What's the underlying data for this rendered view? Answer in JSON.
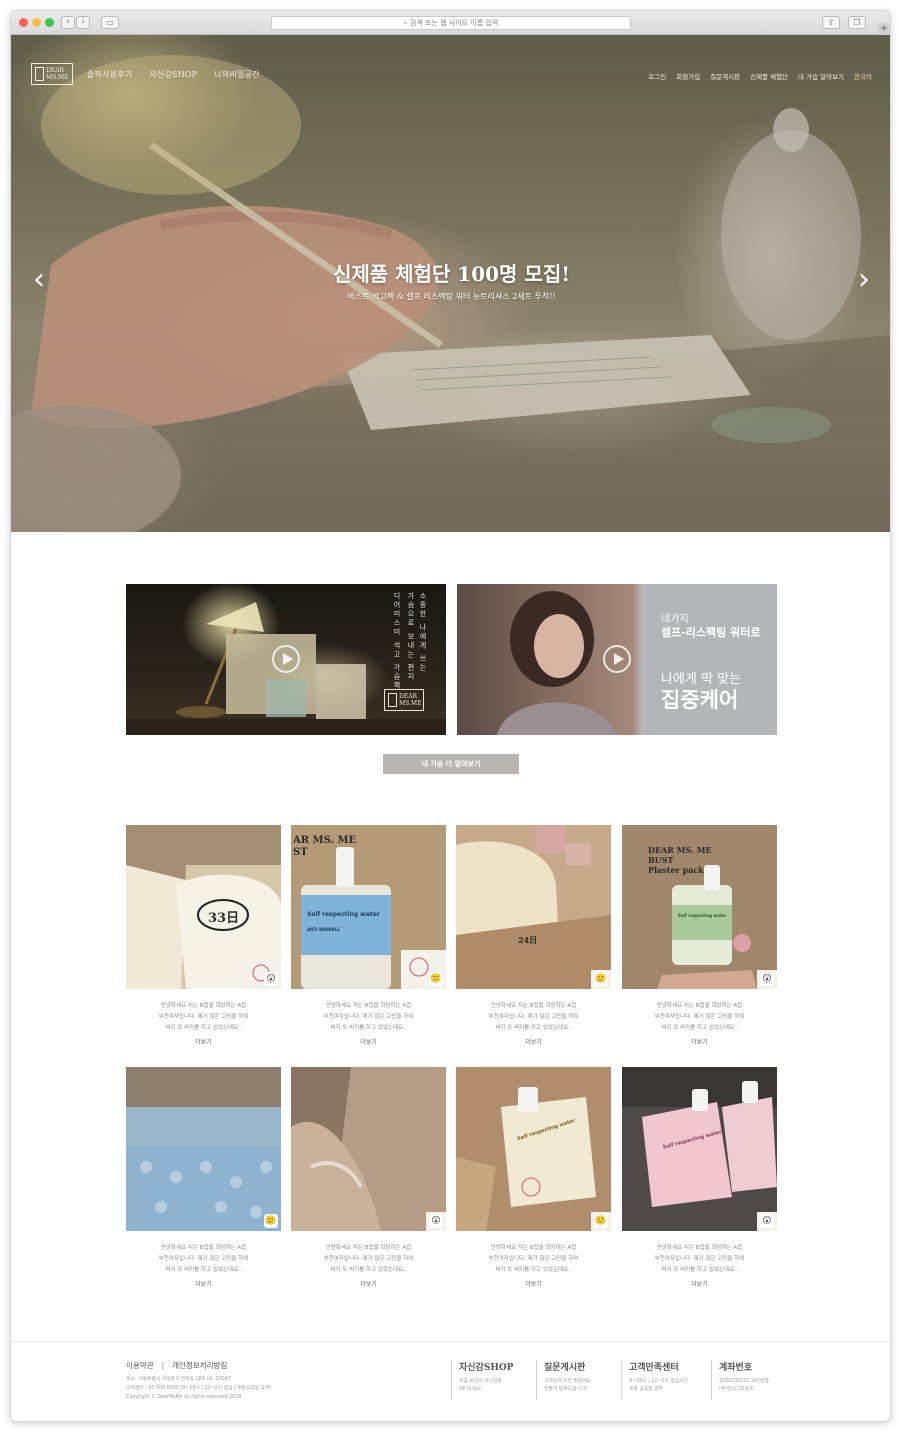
{
  "browser": {
    "address_placeholder": "검색 또는 웹 사이트 이름 입력",
    "back": "‹",
    "forward": "›",
    "new_tab": "+"
  },
  "site": {
    "logo_line1": "DEAR",
    "logo_line2": "MS.ME",
    "main_nav": [
      "솔직사용후기",
      "자신감SHOP",
      "나의비밀공간"
    ],
    "util_nav": [
      "로그인",
      "회원가입",
      "질문게시판",
      "신제품 체험단",
      "내 가슴 알아보기",
      "한국어"
    ]
  },
  "hero": {
    "title": "신제품 체험단 100명 모집!",
    "subtitle": "바스트 석고팩 & 셀프 리스펙팅 워터 뉴트리셔스 2세트 투척!!",
    "prev": "‹",
    "next": "›"
  },
  "videos": {
    "v1_vertical": [
      "소중한 나에게 쓰는",
      "가슴으로 보내는 편지",
      "디어미스미 석고 가슴팩"
    ],
    "v1_badge_line1": "DEAR",
    "v1_badge_line2": "MS.ME",
    "v2_line1": "네가지",
    "v2_line2": "셀프-리스팩팅 워터로",
    "v2_line3": "나에게 딱 맞는",
    "v2_line4": "집중케어"
  },
  "more_button": "내 가슴 더 알아보기",
  "reviews": [
    {
      "text1": "안녕하세요 저는 B컵을 희망하는 A컵",
      "text2": "부천여자입니다. 제가 많은 고민을 하여",
      "text3": "써지 또 써지를 하고 있었는데요..",
      "more": "더보기",
      "emoji": "😲"
    },
    {
      "text1": "안녕하세요 저는 B컵을 희망하는 A컵",
      "text2": "부천여자입니다. 제가 많은 고민을 하여",
      "text3": "써지 또 써지를 하고 있었는데요..",
      "more": "더보기",
      "emoji": "🙂"
    },
    {
      "text1": "안녕하세요 저는 B컵을 희망하는 A컵",
      "text2": "부천여자입니다. 제가 많은 고민을 하여",
      "text3": "써지 또 써지를 하고 있었는데요..",
      "more": "더보기",
      "emoji": "🙂"
    },
    {
      "text1": "안녕하세요 저는 B컵을 희망하는 A컵",
      "text2": "부천여자입니다. 제가 많은 고민을 하여",
      "text3": "써지 또 써지를 하고 있었는데요..",
      "more": "더보기",
      "emoji": "😲"
    },
    {
      "text1": "안녕하세요 저는 B컵을 희망하는 A컵",
      "text2": "부천여자입니다. 제가 많은 고민을 하여",
      "text3": "써지 또 써지를 하고 있었는데요..",
      "more": "더보기",
      "emoji": "🙂"
    },
    {
      "text1": "안녕하세요 저는 B컵을 희망하는 A컵",
      "text2": "부천여자입니다. 제가 많은 고민을 하여",
      "text3": "써지 또 써지를 하고 있었는데요..",
      "more": "더보기",
      "emoji": "😲"
    },
    {
      "text1": "안녕하세요 저는 B컵을 희망하는 A컵",
      "text2": "부천여자입니다. 제가 많은 고민을 하여",
      "text3": "써지 또 써지를 하고 있었는데요..",
      "more": "더보기",
      "emoji": "🙂"
    },
    {
      "text1": "안녕하세요 저는 B컵을 희망하는 A컵",
      "text2": "부천여자입니다. 제가 많은 고민을 하여",
      "text3": "써지 또 써지를 하고 있었는데요..",
      "more": "더보기",
      "emoji": "😲"
    }
  ],
  "thumb_labels": {
    "t1": "33日",
    "t2_brand": "AR MS. ME",
    "t2_brand2": "ST",
    "t2_label": "Self respecting water",
    "t2_label2": "ANTI-WRINKLE",
    "t3": "24日",
    "t4_brand": "DEAR MS. ME",
    "t4_brand2": "BUST",
    "t4_brand3": "Plaster pack",
    "t4_label": "Self respecting water",
    "t7_label": "Self respecting water",
    "t8_label": "Self respecting water"
  },
  "footer": {
    "link1": "이용약관",
    "sep": "|",
    "link2": "개인정보처리방침",
    "info1": "주소: 서울특별시 서대문구 연희동 189-16, 07047",
    "info2": "고객센터 : 00 000 0000 (9~18시 / 12~2시 점심 / 주말공휴일 휴무)",
    "info3": "Copyright © DearMsMe all rights reserved 2018",
    "cols": [
      {
        "title": "자신감SHOP",
        "line1": "지금 당신의 자신감을",
        "line2": "UP 하세요!"
      },
      {
        "title": "질문게시판",
        "line1": "고객님의 어떤 질문에도",
        "line2": "친절히 답해드립니다!"
      },
      {
        "title": "고객만족센터",
        "line1": "9~18시 / 12~2시 점심시간",
        "line2": "주말 공휴일 휴무"
      },
      {
        "title": "계좌번호",
        "line1": "1020230120 국민은행",
        "line2": "(주)언더그라운드"
      }
    ]
  }
}
